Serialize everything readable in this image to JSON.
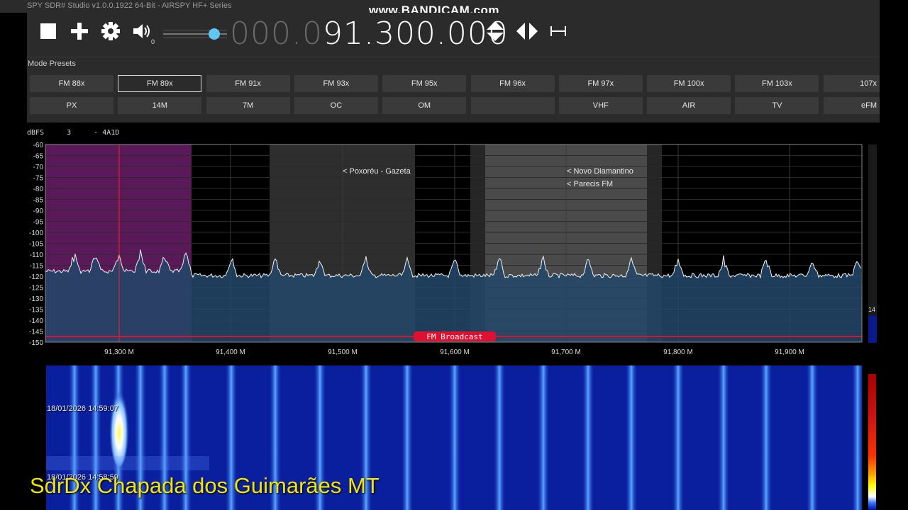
{
  "window": {
    "title": "SPY SDR# Studio v1.0.0.1922 64-Bit - AIRSPY HF+ Series"
  },
  "recorder_watermark": "www.BANDICAM.com",
  "toolbar": {
    "stop_icon": "stop-icon",
    "add_icon": "plus-icon",
    "settings_icon": "gear-icon",
    "volume_icon": "speaker-icon",
    "volume_value": "0",
    "volume_level": 0.8,
    "frequency_dim": "000.0",
    "frequency_main": "91.300.000"
  },
  "presets": {
    "title": "Mode Presets",
    "row1": [
      "FM 88x",
      "FM 89x",
      "FM 91x",
      "FM 93x",
      "FM 95x",
      "FM 96x",
      "FM 97x",
      "FM 100x",
      "FM 103x",
      "107x"
    ],
    "row2": [
      "PX",
      "14M",
      "7M",
      "OC",
      "OM",
      "",
      "VHF",
      "AIR",
      "TV",
      "eFM"
    ],
    "selected": "FM 89x"
  },
  "spectrum": {
    "header_unit": "dBFS",
    "header_value": "3",
    "header_code": "- 4A1D",
    "y_ticks": [
      "-60",
      "-65",
      "-70",
      "-75",
      "-80",
      "-85",
      "-90",
      "-95",
      "-100",
      "-105",
      "-110",
      "-115",
      "-120",
      "-125",
      "-130",
      "-135",
      "-140",
      "-145",
      "-150"
    ],
    "x_ticks": [
      "91,300 M",
      "91,400 M",
      "91,500 M",
      "91,600 M",
      "91,700 M",
      "91,800 M",
      "91,900 M"
    ],
    "band_label": "FM Broadcast",
    "station_labels": [
      "< Poxoréu - Gazeta",
      "< Novo Diamantino",
      "< Parecis FM"
    ],
    "side_value": "14",
    "colors": {
      "trace": "#f2f2f2",
      "fill": "#23486a",
      "band_line": "#e01030",
      "selected_band": "#6a1f6a",
      "marker": "#ff2020"
    }
  },
  "waterfall": {
    "timestamps": [
      "18/01/2026 14:59:07",
      "18/01/2026 14:58:59"
    ]
  },
  "overlay_caption": "SdrDx Chapada dos Guimarães MT"
}
